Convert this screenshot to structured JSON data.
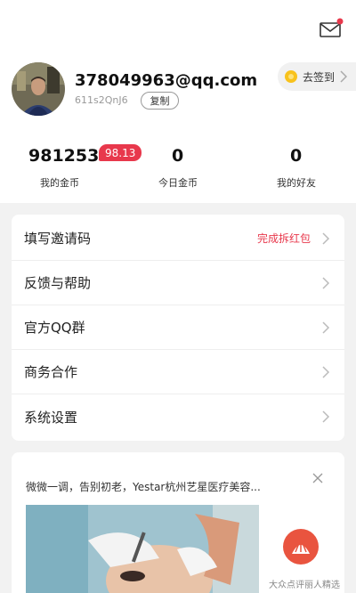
{
  "header": {
    "mail_icon": "mail-icon",
    "has_notification_dot": true
  },
  "profile": {
    "email": "378049963@qq.com",
    "uid": "611s2QnJ6",
    "copy_label": "复制",
    "checkin_label": "去签到"
  },
  "stats": [
    {
      "value": "981253",
      "label": "我的金币",
      "badge": "98.13"
    },
    {
      "value": "0",
      "label": "今日金币"
    },
    {
      "value": "0",
      "label": "我的好友"
    }
  ],
  "menu": [
    {
      "label": "填写邀请码",
      "extra": "完成拆红包"
    },
    {
      "label": "反馈与帮助"
    },
    {
      "label": "官方QQ群"
    },
    {
      "label": "商务合作"
    },
    {
      "label": "系统设置"
    }
  ],
  "ad": {
    "title": "微微一调，告别初老，Yestar杭州艺星医疗美容...",
    "brand": "大众点评丽人精选"
  },
  "colors": {
    "accent_red": "#e8384c",
    "coin_yellow": "#f8c21c",
    "background": "#f2f2f2"
  }
}
